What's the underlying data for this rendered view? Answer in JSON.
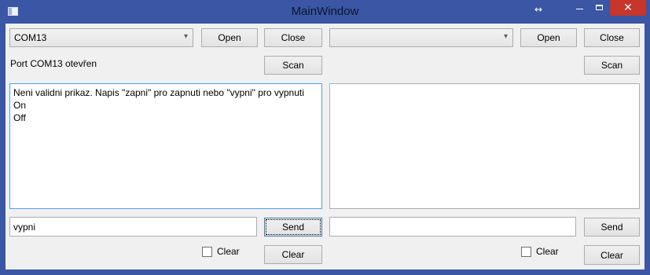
{
  "window": {
    "title": "MainWindow"
  },
  "left": {
    "port_selected": "COM13",
    "open_label": "Open",
    "close_label": "Close",
    "status": "Port COM13 otevřen",
    "scan_label": "Scan",
    "log_lines": [
      "Neni validni prikaz. Napis \"zapni\" pro zapnuti nebo \"vypni\" pro vypnuti",
      "On",
      "Off"
    ],
    "input_value": "vypni",
    "send_label": "Send",
    "clear_checkbox_label": "Clear",
    "clear_button_label": "Clear"
  },
  "right": {
    "port_selected": "",
    "open_label": "Open",
    "close_label": "Close",
    "status": "",
    "scan_label": "Scan",
    "log_lines": [],
    "input_value": "",
    "send_label": "Send",
    "clear_checkbox_label": "Clear",
    "clear_button_label": "Clear"
  }
}
